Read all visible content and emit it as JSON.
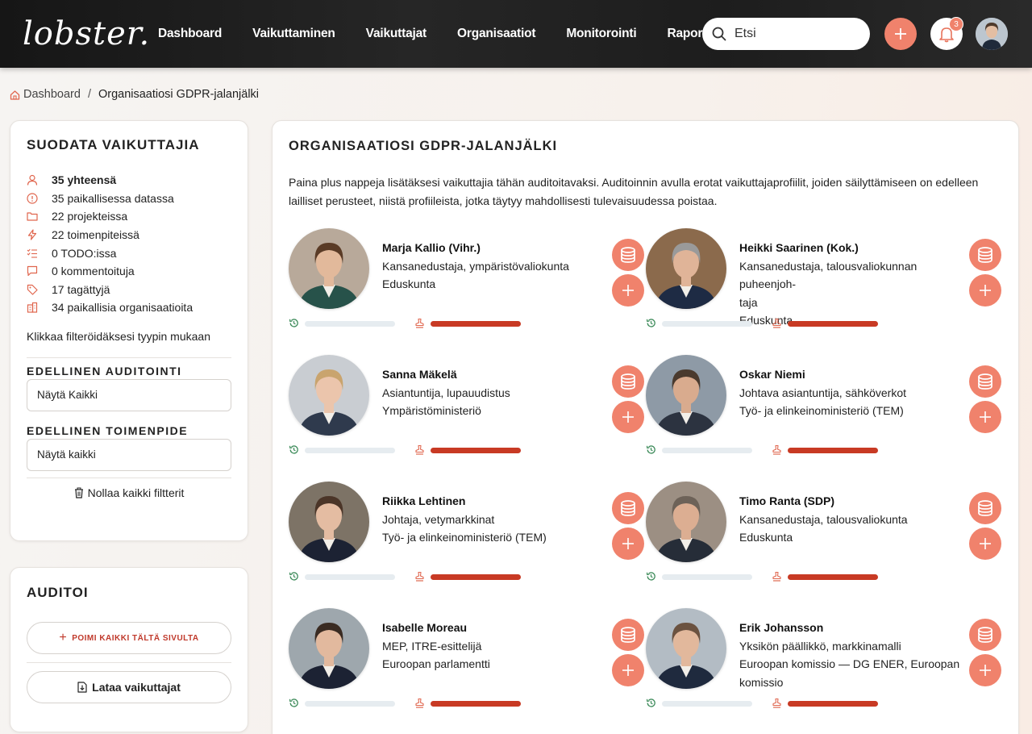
{
  "brand": {
    "logo_text": "lobster."
  },
  "nav": [
    "Dashboard",
    "Vaikuttaminen",
    "Vaikuttajat",
    "Organisaatiot",
    "Monitorointi",
    "Raportit"
  ],
  "search": {
    "placeholder": "Etsi"
  },
  "notifications": {
    "count": "3"
  },
  "breadcrumb": {
    "home": "Dashboard",
    "separator": "/",
    "current": "Organisaatiosi GDPR-jalanjälki"
  },
  "filters": {
    "title": "SUODATA VAIKUTTAJIA",
    "stats": [
      {
        "icon": "user-icon",
        "label": "35 yhteensä"
      },
      {
        "icon": "info-circle-icon",
        "label": "35 paikallisessa datassa"
      },
      {
        "icon": "folder-icon",
        "label": "22 projekteissa"
      },
      {
        "icon": "lightning-icon",
        "label": "22 toimenpiteissä"
      },
      {
        "icon": "checklist-icon",
        "label": "0 TODO:issa"
      },
      {
        "icon": "comment-icon",
        "label": "0 kommentoituja"
      },
      {
        "icon": "tag-icon",
        "label": "17 tagättyjä"
      },
      {
        "icon": "building-icon",
        "label": "34 paikallisia organisaatioita"
      }
    ],
    "hint": "Klikkaa filteröidäksesi tyypin mukaan",
    "prev_audit_label": "EDELLINEN AUDITOINTI",
    "prev_audit_value": "Näytä Kaikki",
    "prev_action_label": "EDELLINEN TOIMENPIDE",
    "prev_action_value": "Näytä kaikki",
    "reset_label": "Nollaa kaikki filtterit"
  },
  "audit": {
    "title": "AUDITOI",
    "pick_all_label": "POIMI KAIKKI TÄLTÄ SIVULTA",
    "download_label": "Lataa vaikuttajat"
  },
  "main": {
    "title": "ORGANISAATIOSI GDPR-JALANJÄLKI",
    "intro": "Paina plus nappeja lisätäksesi vaikuttajia tähän auditoitavaksi. Auditoinnin avulla erotat vaikuttajaprofiilit, joiden säilyttämiseen on edelleen lailliset perusteet, niistä profiileista, jotka täytyy mahdollisesti tulevaisuudessa poistaa.",
    "influencers": [
      {
        "name": "Marja Kallio (Vihr.)",
        "lines": [
          "Kansanedustaja, ympäristövaliokunta",
          "Eduskunta"
        ],
        "skin": "#e2b99b",
        "hair": "#5a3b26",
        "suit": "#27524a",
        "bg": "#b8a99a"
      },
      {
        "name": "Heikki Saarinen (Kok.)",
        "lines": [
          "Kansanedustaja, talousvaliokunnan puheenjoh-",
          "taja",
          "Eduskunta"
        ],
        "skin": "#e0b498",
        "hair": "#9a9a9a",
        "suit": "#1e2b44",
        "bg": "#8b6a4c"
      },
      {
        "name": "Sanna Mäkelä",
        "lines": [
          "Asiantuntija, lupauudistus",
          "Ympäristöministeriö"
        ],
        "skin": "#ebc5ac",
        "hair": "#c9a46e",
        "suit": "#2f3a4d",
        "bg": "#c9cdd2"
      },
      {
        "name": "Oskar Niemi",
        "lines": [
          "Johtava asiantuntija, sähköverkot",
          "Työ- ja elinkeinoministeriö (TEM)"
        ],
        "skin": "#d9ab8e",
        "hair": "#4a3a2e",
        "suit": "#2c3340",
        "bg": "#8e9aa6"
      },
      {
        "name": "Riikka Lehtinen",
        "lines": [
          "Johtaja, vetymarkkinat",
          "Työ- ja elinkeinoministeriö (TEM)"
        ],
        "skin": "#e4bca2",
        "hair": "#4b3528",
        "suit": "#1c2233",
        "bg": "#7d7366"
      },
      {
        "name": "Timo Ranta (SDP)",
        "lines": [
          "Kansanedustaja, talousvaliokunta",
          "Eduskunta"
        ],
        "skin": "#dcae92",
        "hair": "#6d6258",
        "suit": "#262d38",
        "bg": "#9c8f83"
      },
      {
        "name": "Isabelle Moreau",
        "lines": [
          "MEP, ITRE-esittelijä",
          "Euroopan parlamentti"
        ],
        "skin": "#e2b99e",
        "hair": "#3a2b22",
        "suit": "#1c2233",
        "bg": "#9ea7ad"
      },
      {
        "name": "Erik Johansson",
        "lines": [
          "Yksikön päällikkö, markkinamalli",
          "Euroopan komissio — DG ENER, Euroopan",
          "komissio"
        ],
        "skin": "#e2b89c",
        "hair": "#6b5240",
        "suit": "#1f2a3e",
        "bg": "#b3bcc4"
      }
    ]
  },
  "colors": {
    "accent": "#f0826c",
    "danger_bar": "#c83a24",
    "history_green": "#3d8b5a"
  }
}
